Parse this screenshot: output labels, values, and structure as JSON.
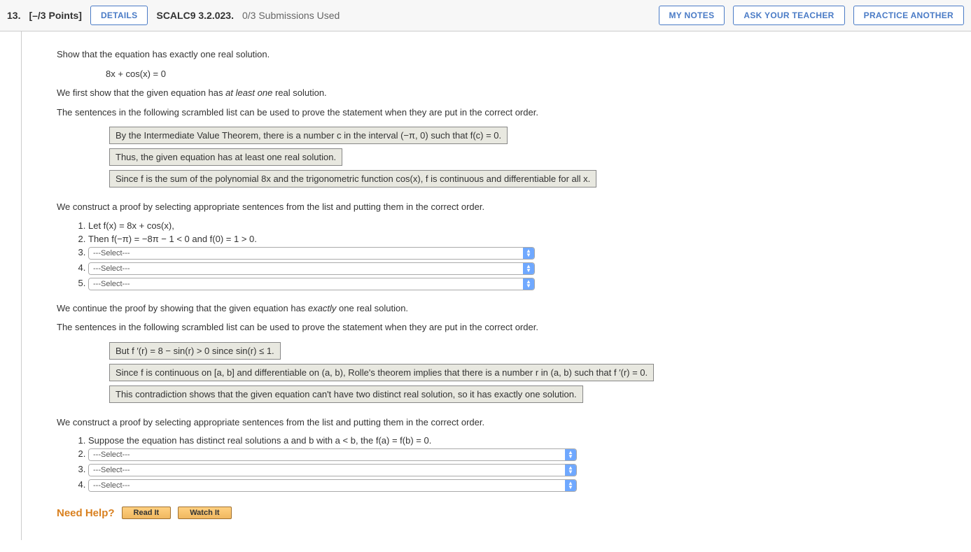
{
  "header": {
    "qnum": "13.",
    "points": "[–/3 Points]",
    "details_btn": "DETAILS",
    "refcode": "SCALC9 3.2.023.",
    "submissions": "0/3 Submissions Used",
    "my_notes_btn": "MY NOTES",
    "ask_teacher_btn": "ASK YOUR TEACHER",
    "practice_btn": "PRACTICE ANOTHER"
  },
  "body": {
    "prompt": "Show that the equation has exactly one real solution.",
    "equation": "8x + cos(x) = 0",
    "intro1_a": "We first show that the given equation has ",
    "intro1_i": "at least one",
    "intro1_b": " real solution.",
    "scramble_intro": "The sentences in the following scrambled list can be used to prove the statement when they are put in the correct order.",
    "scrambled1": [
      "By the Intermediate Value Theorem, there is a number c in the interval (−π, 0) such that f(c) = 0.",
      "Thus, the given equation has at least one real solution.",
      "Since f is the sum of the polynomial 8x and the trigonometric function cos(x), f is continuous and differentiable for all x."
    ],
    "construct_intro": "We construct a proof by selecting appropriate sentences from the list and putting them in the correct order.",
    "proof1_step1": "Let f(x) = 8x + cos(x),",
    "proof1_step2": "Then f(−π) = −8π − 1 < 0 and f(0) = 1 > 0.",
    "select_placeholder": "---Select---",
    "continue_a": "We continue the proof by showing that the given equation has ",
    "continue_i": "exactly",
    "continue_b": " one real solution.",
    "scrambled2": [
      "But f ′(r) = 8 − sin(r) > 0 since sin(r) ≤ 1.",
      "Since f is continuous on [a, b] and differentiable on (a, b), Rolle's theorem implies that there is a number r in (a, b) such that f ′(r) = 0.",
      "This contradiction shows that the given equation can't have two distinct real solution, so it has exactly one solution."
    ],
    "proof2_step1": "Suppose the equation has distinct real solutions a and b with a < b, the f(a) = f(b) = 0.",
    "need_help_label": "Need Help?",
    "read_it_btn": "Read It",
    "watch_it_btn": "Watch It"
  }
}
